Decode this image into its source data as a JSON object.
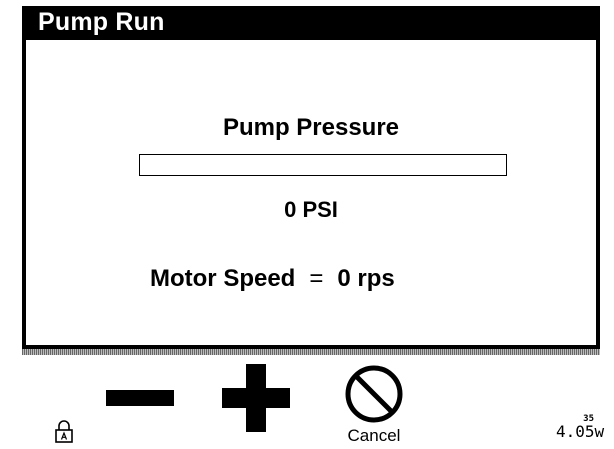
{
  "window": {
    "title": "Pump Run"
  },
  "pressure": {
    "label": "Pump Pressure",
    "value": "0 PSI",
    "fill_fraction": 0
  },
  "motor": {
    "label": "Motor Speed",
    "equals": "=",
    "value": "0 rps"
  },
  "controls": {
    "lock_icon": "lock-icon",
    "decrease_icon": "minus-icon",
    "increase_icon": "plus-icon",
    "cancel_icon": "prohibited-circle-icon",
    "cancel_label": "Cancel"
  },
  "status": {
    "top": "35",
    "bottom": "4.05w"
  },
  "colors": {
    "foreground": "#000000",
    "background": "#ffffff"
  }
}
